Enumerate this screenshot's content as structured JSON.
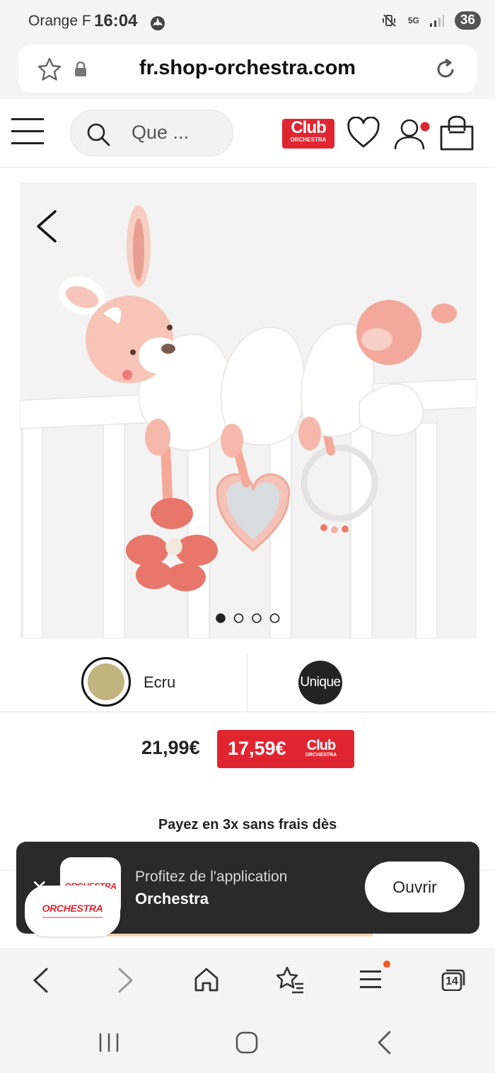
{
  "status_bar": {
    "carrier": "Orange F",
    "time": "16:04",
    "network": "5G",
    "battery": "36"
  },
  "browser": {
    "url": "fr.shop-orchestra.com",
    "tab_count": "14"
  },
  "header": {
    "search_placeholder": "Que ...",
    "club_logo_main": "Club",
    "club_logo_sub": "ORCHESTRA"
  },
  "gallery": {
    "image_count": 4,
    "active_index": 0
  },
  "variants": {
    "color_label": "Ecru",
    "color_hex": "#c2b47f",
    "size_label": "Unique"
  },
  "price": {
    "regular": "21,99€",
    "club": "17,59€",
    "club_badge_main": "Club",
    "club_badge_sub": "ORCHESTRA",
    "installments_text": "Payez en 3x sans frais dès"
  },
  "app_banner": {
    "title": "Profitez de l'application",
    "app_name": "Orchestra",
    "open_label": "Ouvrir",
    "icon_brand": "ORCHESTRA"
  },
  "colors": {
    "brand_red": "#e02531",
    "banner_bg": "#2a2a2a",
    "chrome_bg": "#f4f4f4"
  }
}
